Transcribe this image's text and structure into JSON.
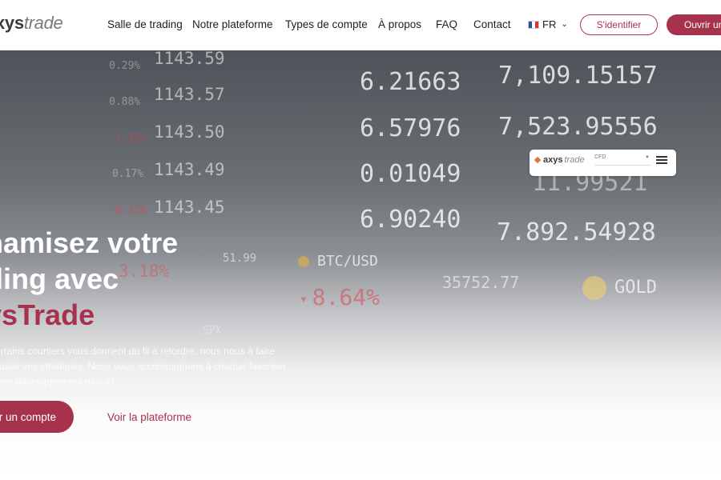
{
  "header": {
    "logo_part1": "xys",
    "logo_part2": "trade",
    "nav": [
      "Salle de trading",
      "Notre plateforme",
      "Types de compte",
      "À propos",
      "FAQ",
      "Contact"
    ],
    "language": "FR",
    "login_label": "S'identifier",
    "open_account_label": "Ouvrir un c"
  },
  "hero": {
    "ticker_big": [
      "6.21663",
      "6.57976",
      "0.01049",
      "6.90240",
      "7,109.15157",
      "7,523.95556",
      "11.99521",
      "7.892.54928"
    ],
    "ticker_mid": [
      "1143.59",
      "1143.57",
      "1143.50",
      "1143.49",
      "1143.45"
    ],
    "ticker_pct": [
      "0.29%",
      "0.88%",
      "-1.32%",
      "0.17%",
      "-0.12%"
    ],
    "crypto_label": "BTC/USD",
    "crypto_pct": "8.64%",
    "crypto_value": "35752.77",
    "gold_label": "GOLD",
    "misc": [
      "51.99",
      "3.18%",
      "SPX"
    ],
    "widget": {
      "logo_part1": "axys",
      "logo_part2": "trade",
      "select_value": "CFD"
    },
    "headline_line1": "namisez votre",
    "headline_line2": "ding avec",
    "headline_accent": "ysTrade",
    "description": "certains courtiers vous donnent du fil à retordre, nous nous à faire réussir vos stratégies. Nous vous accompagnons à chaque favoriser notre développement mutuel.",
    "cta_primary": "r un compte",
    "cta_secondary": "Voir la plateforme"
  },
  "colors": {
    "brand": "#a6324e",
    "text": "#222222"
  }
}
